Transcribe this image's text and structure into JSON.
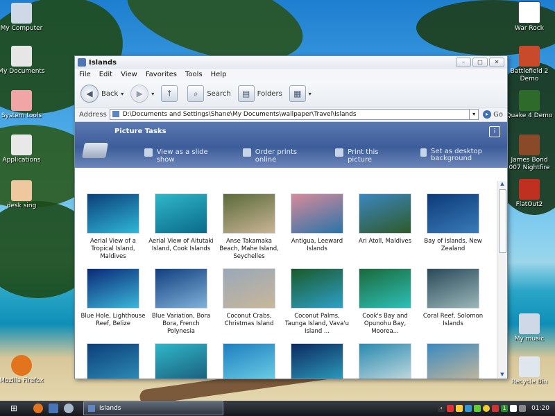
{
  "desktop_left": [
    {
      "label": "My Computer",
      "color": "#cfd8e6"
    },
    {
      "label": "My Documents",
      "color": "#e6e6e6"
    },
    {
      "label": "System tools",
      "color": "#f0a6a6"
    },
    {
      "label": "Applications",
      "color": "#e8e8e8"
    },
    {
      "label": "desk sing",
      "color": "#f0c8a0"
    },
    {
      "label": "Mozilla Firefox",
      "color": "#e2741e"
    }
  ],
  "desktop_right": [
    {
      "label": "War Rock",
      "color": "#ffffff"
    },
    {
      "label": "Battlefield 2 Demo",
      "color": "#c84a2a"
    },
    {
      "label": "Quake 4 Demo",
      "color": "#2e6a2a"
    },
    {
      "label": "James Bond 007 Nightfire",
      "color": "#8a4a2a"
    },
    {
      "label": "FlatOut2",
      "color": "#c03020"
    },
    {
      "label": "My music",
      "color": "#cfd8e6"
    },
    {
      "label": "Recycle Bin",
      "color": "#e0e6ee"
    }
  ],
  "window": {
    "title": "Islands",
    "buttons": {
      "min": "–",
      "max": "□",
      "close": "✕"
    },
    "menus": [
      "File",
      "Edit",
      "View",
      "Favorites",
      "Tools",
      "Help"
    ],
    "toolbar": {
      "back": "Back",
      "search": "Search",
      "folders": "Folders"
    },
    "address": {
      "label": "Address",
      "path": "D:\\Documents and Settings\\Shane\\My Documents\\wallpaper\\Travel\\Islands",
      "go": "Go"
    },
    "tasks": {
      "title": "Picture Tasks",
      "items": [
        "View as a slide show",
        "Order prints online",
        "Print this picture",
        "Set as desktop background"
      ]
    },
    "thumbnails": [
      {
        "caption": "Aerial View of a Tropical Island, Maldives",
        "c1": "#0b3f7a",
        "c2": "#2fb7d6"
      },
      {
        "caption": "Aerial View of Aitutaki Island, Cook Islands",
        "c1": "#2fb7c8",
        "c2": "#0b6a8a"
      },
      {
        "caption": "Anse Takamaka Beach, Mahe Island, Seychelles",
        "c1": "#5a6a38",
        "c2": "#c9b596"
      },
      {
        "caption": "Antigua, Leeward Islands",
        "c1": "#d88a9a",
        "c2": "#2a74a8"
      },
      {
        "caption": "Ari Atoll, Maldives",
        "c1": "#3b86c0",
        "c2": "#2f5a2a"
      },
      {
        "caption": "Bay of Islands, New Zealand",
        "c1": "#0c3a78",
        "c2": "#3a7ab8"
      },
      {
        "caption": "Blue Hole, Lighthouse Reef, Belize",
        "c1": "#0a2a78",
        "c2": "#3bb6d8"
      },
      {
        "caption": "Blue Variation, Bora Bora, French Polynesia",
        "c1": "#123f80",
        "c2": "#7fb2d8"
      },
      {
        "caption": "Coconut Crabs, Christmas Island",
        "c1": "#9aa8b8",
        "c2": "#c8b79a"
      },
      {
        "caption": "Coconut Palms, Taunga Island, Vava'u Island ...",
        "c1": "#1a5a2a",
        "c2": "#2ea0c8"
      },
      {
        "caption": "Cook's Bay and Opunohu Bay, Moorea...",
        "c1": "#1a6a3a",
        "c2": "#2ec0b8"
      },
      {
        "caption": "Coral Reef, Solomon Islands",
        "c1": "#2a4a5a",
        "c2": "#9ab6b8"
      },
      {
        "caption": "",
        "c1": "#0b3f7a",
        "c2": "#2f8fb6"
      },
      {
        "caption": "",
        "c1": "#2fb7c8",
        "c2": "#1a5a78"
      },
      {
        "caption": "",
        "c1": "#1e7fc0",
        "c2": "#6fd0e6"
      },
      {
        "caption": "",
        "c1": "#0b2a60",
        "c2": "#2fa0c0"
      },
      {
        "caption": "",
        "c1": "#2a8ab0",
        "c2": "#c8dce0"
      },
      {
        "caption": "",
        "c1": "#3a8ac0",
        "c2": "#c8b89a"
      }
    ]
  },
  "taskbar": {
    "task": "Islands",
    "clock": "01:20",
    "tray_extra": "1"
  }
}
